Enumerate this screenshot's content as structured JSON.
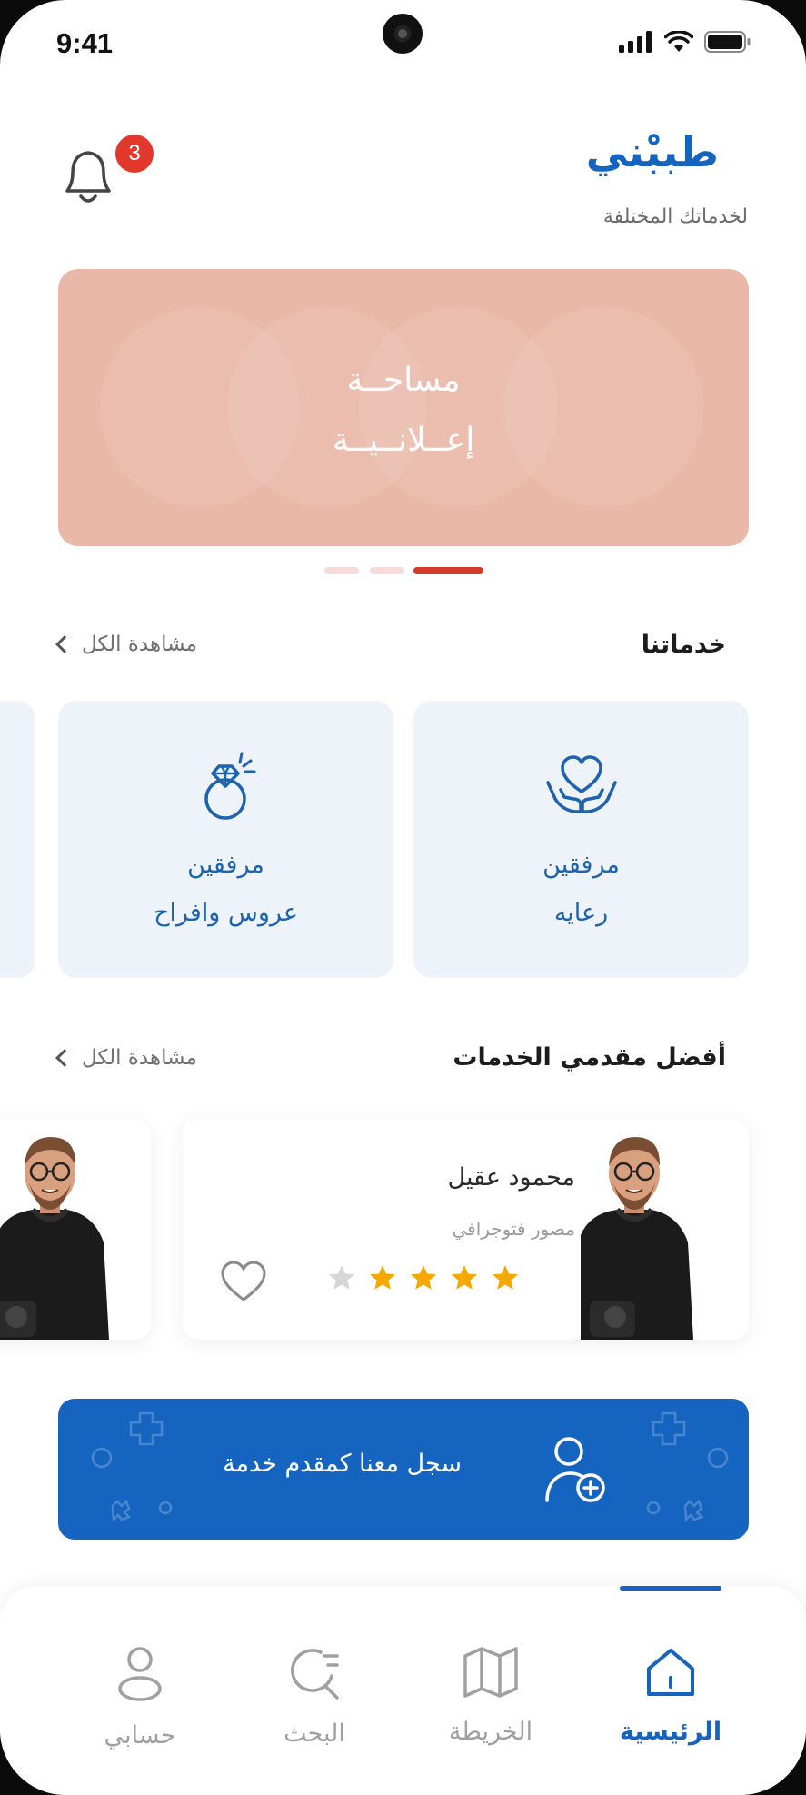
{
  "status_bar": {
    "time": "9:41"
  },
  "header": {
    "logo": "طببْني",
    "tagline": "لخدماتك المختلفة",
    "notification_count": "3"
  },
  "banner": {
    "line1": "مساحــة",
    "line2": "إعــلانــيــة"
  },
  "carousel": {
    "count": 3,
    "active_index": 2
  },
  "services_section": {
    "title": "خدماتنا",
    "see_all": "مشاهدة الكل",
    "items": [
      {
        "icon": "care-hands-heart-icon",
        "line1": "مرفقين",
        "line2": "رعايه"
      },
      {
        "icon": "ring-diamond-icon",
        "line1": "مرفقين",
        "line2": "عروس وافراح"
      }
    ]
  },
  "providers_section": {
    "title": "أفضل مقدمي الخدمات",
    "see_all": "مشاهدة الكل",
    "items": [
      {
        "name": "محمود عقيل",
        "role": "مصور فتوجرافي",
        "rating": 4,
        "max_rating": 5
      }
    ]
  },
  "cta": {
    "label": "سجل معنا كمقدم خدمة"
  },
  "bottom_nav": {
    "items": [
      {
        "label": "الرئيسية",
        "icon": "home-icon",
        "active": true
      },
      {
        "label": "الخريطة",
        "icon": "map-icon",
        "active": false
      },
      {
        "label": "البحث",
        "icon": "search-icon",
        "active": false
      },
      {
        "label": "حسابي",
        "icon": "user-icon",
        "active": false
      }
    ]
  },
  "colors": {
    "primary": "#1565c0",
    "banner": "#e9b8a8",
    "badge": "#e2382b",
    "star": "#f5a800",
    "card_bg": "#eef3f9"
  }
}
